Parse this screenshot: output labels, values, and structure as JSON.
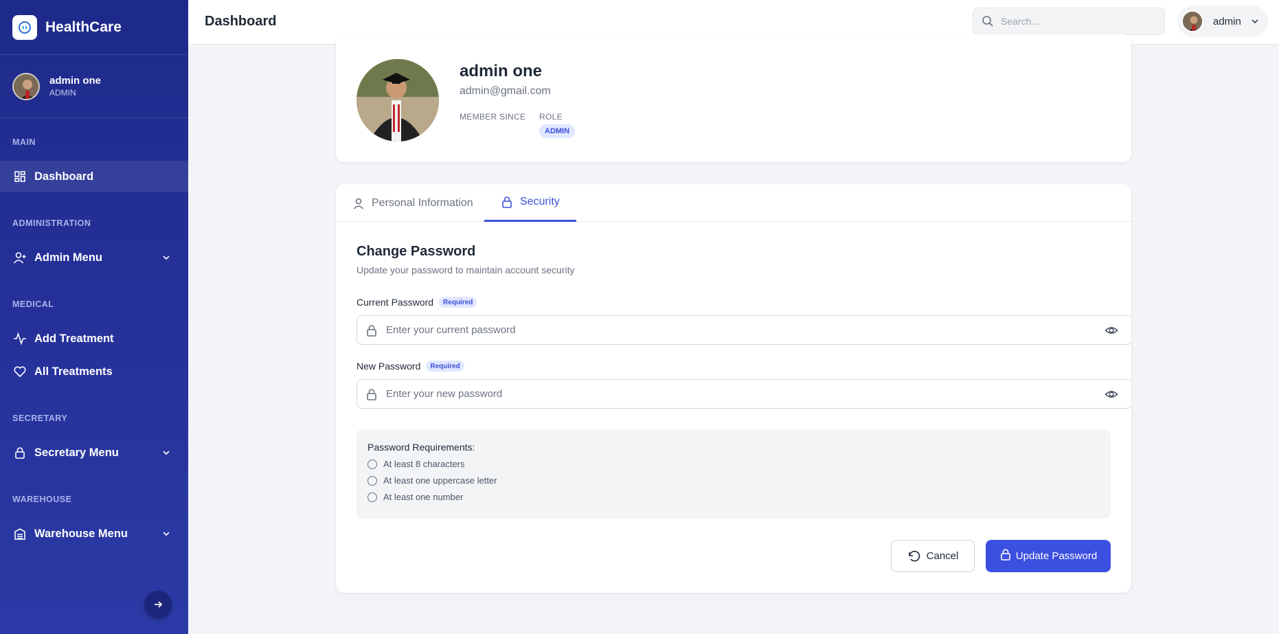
{
  "brand": {
    "name": "HealthCare"
  },
  "sidebar": {
    "user": {
      "name": "admin one",
      "role": "ADMIN"
    },
    "sections": {
      "main": "MAIN",
      "administration": "ADMINISTRATION",
      "medical": "MEDICAL",
      "secretary": "SECRETARY",
      "warehouse": "WAREHOUSE"
    },
    "items": {
      "dashboard": "Dashboard",
      "admin_menu": "Admin Menu",
      "add_treatment": "Add Treatment",
      "all_treatments": "All Treatments",
      "secretary_menu": "Secretary Menu",
      "warehouse_menu": "Warehouse Menu"
    },
    "active_item": "Dashboard"
  },
  "header": {
    "title": "Dashboard",
    "search_placeholder": "Search...",
    "user_name": "admin"
  },
  "profile": {
    "name": "admin one",
    "email": "admin@gmail.com",
    "member_since_label": "MEMBER SINCE",
    "member_since_value": "",
    "role_label": "ROLE",
    "role_value": "ADMIN"
  },
  "tabs": {
    "personal": "Personal Information",
    "security": "Security",
    "active": "Security"
  },
  "security": {
    "title": "Change Password",
    "subtitle": "Update your password to maintain account security",
    "current_label": "Current Password",
    "new_label": "New Password",
    "required_badge": "Required",
    "current_placeholder": "Enter your current password",
    "new_placeholder": "Enter your new password",
    "requirements_title": "Password Requirements:",
    "requirements": [
      "At least 8 characters",
      "At least one uppercase letter",
      "At least one number"
    ],
    "cancel_label": "Cancel",
    "update_label": "Update Password"
  },
  "colors": {
    "sidebar": "#1e2a8a",
    "accent": "#3b4fd8",
    "button": "#3b4fe0",
    "background": "#f3f4f7"
  },
  "icons": {
    "dashboard": "grid-icon",
    "admin_menu": "user-plus-icon",
    "add_treatment": "activity-icon",
    "all_treatments": "heart-icon",
    "secretary_menu": "lock-icon",
    "warehouse_menu": "warehouse-icon"
  }
}
